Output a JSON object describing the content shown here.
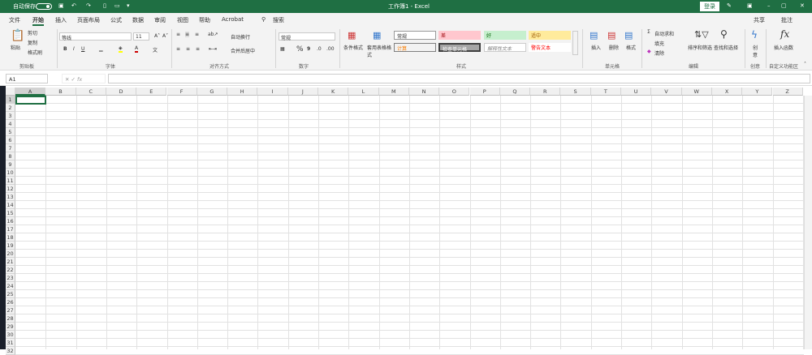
{
  "title_bar": {
    "autosave": "自动保存",
    "toggle": "关",
    "title": "工作簿1 - Excel",
    "sign_in": "登录"
  },
  "menu": [
    "文件",
    "开始",
    "插入",
    "页面布局",
    "公式",
    "数据",
    "审阅",
    "视图",
    "帮助",
    "Acrobat",
    "搜索"
  ],
  "share": "共享",
  "comments": "批注",
  "ribbon": {
    "clipboard": {
      "paste": "粘贴",
      "cut": "剪切",
      "copy": "复制",
      "format_painter": "格式刷",
      "label": "剪贴板"
    },
    "font": {
      "name": "等线",
      "size": "11",
      "bold": "B",
      "italic": "I",
      "underline": "U",
      "label": "字体"
    },
    "alignment": {
      "wrap": "自动换行",
      "merge": "合并后居中",
      "label": "对齐方式"
    },
    "number": {
      "format": "常规",
      "percent": "%",
      "comma": "9",
      "label": "数字"
    },
    "styles": {
      "conditional": "条件格式",
      "table": "套用表格格式",
      "cells": [
        "常规",
        "差",
        "好",
        "适中",
        "计算",
        "检查单元格",
        "解释性文本",
        "警告文本"
      ],
      "label": "样式"
    },
    "cells": {
      "insert": "插入",
      "delete": "删除",
      "format": "格式",
      "label": "单元格"
    },
    "editing": {
      "autosum": "自动求和",
      "fill": "填充",
      "clear": "清除",
      "sort": "排序和筛选",
      "find": "查找和选择",
      "label": "编辑"
    },
    "create": {
      "btn": "创意",
      "label": "创意"
    },
    "custom": {
      "btn": "插入函数",
      "label": "自定义功能区"
    }
  },
  "formula_bar": {
    "name_box": "A1",
    "fx": "fx",
    "value": ""
  },
  "columns": [
    "A",
    "B",
    "C",
    "D",
    "E",
    "F",
    "G",
    "H",
    "I",
    "J",
    "K",
    "L",
    "M",
    "N",
    "O",
    "P",
    "Q",
    "R",
    "S",
    "T",
    "U",
    "V",
    "W",
    "X",
    "Y",
    "Z"
  ],
  "rows": [
    "1",
    "2",
    "3",
    "4",
    "5",
    "6",
    "7",
    "8",
    "9",
    "10",
    "11",
    "12",
    "13",
    "14",
    "15",
    "16",
    "17",
    "18",
    "19",
    "20",
    "21",
    "22",
    "23",
    "24",
    "25",
    "26",
    "27",
    "28",
    "29",
    "30",
    "31",
    "32"
  ],
  "colors": {
    "accent": "#1f6f43"
  }
}
